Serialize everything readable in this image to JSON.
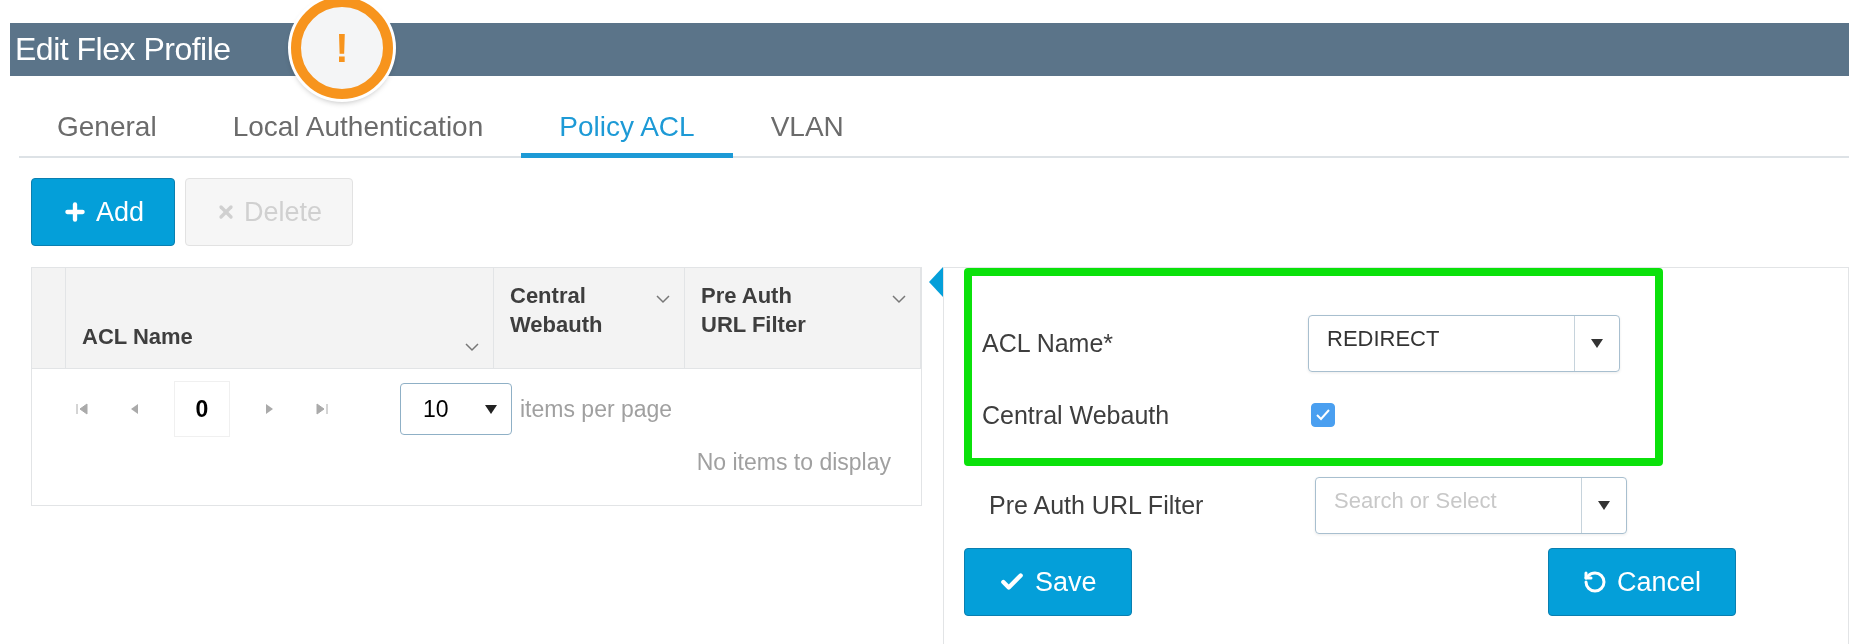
{
  "header": {
    "title": "Edit Flex Profile",
    "alert": {
      "symbol": "!"
    }
  },
  "tabs": [
    {
      "label": "General",
      "selected": false
    },
    {
      "label": "Local Authentication",
      "selected": false
    },
    {
      "label": "Policy ACL",
      "selected": true
    },
    {
      "label": "VLAN",
      "selected": false
    }
  ],
  "toolbar": [
    {
      "label": "Add",
      "kind": "add",
      "disabled": false
    },
    {
      "label": "Delete",
      "kind": "delete",
      "disabled": true
    }
  ],
  "table": {
    "columns": [
      {
        "label": "ACL Name"
      },
      {
        "label": "Central Webauth"
      },
      {
        "label": "Pre Auth URL Filter"
      }
    ],
    "pager": {
      "page": "0",
      "page_size": "10",
      "page_size_label": "items per page",
      "empty_message": "No items to display"
    }
  },
  "form": {
    "fields": [
      {
        "kind": "select",
        "label": "ACL Name*",
        "value": "REDIRECT",
        "highlighted": true
      },
      {
        "kind": "checkbox",
        "label": "Central Webauth",
        "checked": true,
        "highlighted": true
      },
      {
        "kind": "select",
        "label": "Pre Auth URL Filter",
        "placeholder": "Search or Select",
        "highlighted": false
      }
    ],
    "buttons": [
      {
        "label": "Save",
        "kind": "save"
      },
      {
        "label": "Cancel",
        "kind": "cancel"
      }
    ]
  }
}
